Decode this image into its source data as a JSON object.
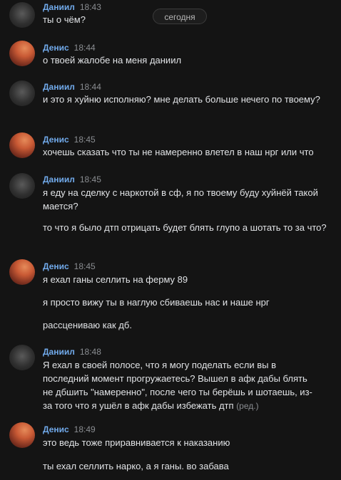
{
  "date_divider": "сегодня",
  "messages": [
    {
      "author": "Даниил",
      "time": "18:43",
      "lines": [
        "ты о чём?"
      ]
    },
    {
      "author": "Денис",
      "time": "18:44",
      "lines": [
        "о твоей жалобе на меня даниил"
      ]
    },
    {
      "author": "Даниил",
      "time": "18:44",
      "lines": [
        "и это я хуйню исполняю? мне делать больше нечего по твоему?"
      ]
    },
    {
      "author": "Денис",
      "time": "18:45",
      "lines": [
        "хочешь сказать что ты не намеренно влетел в наш нрг или что"
      ]
    },
    {
      "author": "Даниил",
      "time": "18:45",
      "lines": [
        "я еду на сделку с наркотой в сф, я по твоему буду хуйнёй такой мается?",
        "то что я было дтп отрицать будет блять глупо а шотать то за что?"
      ]
    },
    {
      "author": "Денис",
      "time": "18:45",
      "lines": [
        "я ехал ганы селлить на ферму 89",
        "я просто вижу ты в наглую сбиваешь нас и наше нрг",
        "рассцениваю как дб."
      ]
    },
    {
      "author": "Даниил",
      "time": "18:48",
      "lines": [
        "Я ехал в своей полосе, что я могу поделать если вы в последний момент прогружаетесь? Вышел в афк дабы блять не дбшить \"намеренно\", после чего ты берёшь и шотаешь, из-за того что я ушёл в афк дабы избежать дтп"
      ],
      "edited": "(ред.)"
    },
    {
      "author": "Денис",
      "time": "18:49",
      "lines": [
        "это ведь тоже приравнивается к наказанию",
        "ты ехал селлить нарко, а я ганы. во забава"
      ]
    }
  ]
}
